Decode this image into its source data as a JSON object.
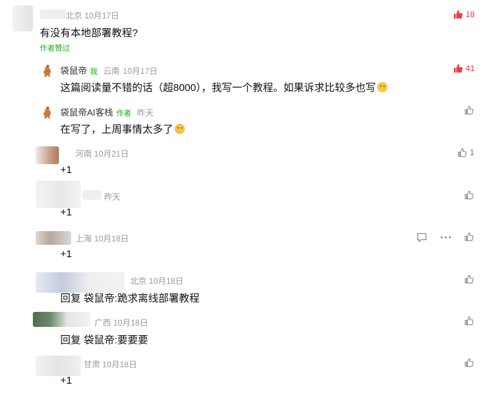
{
  "comments": [
    {
      "location": "北京",
      "date": "10月17日",
      "text": "有没有本地部署教程?",
      "author_liked": "作者赞过",
      "likes": "18"
    },
    {
      "name": "袋鼠帝",
      "tag": "我",
      "location": "云南",
      "date": "10月17日",
      "text": "这篇阅读量不错的话（超8000），我写一个教程。如果诉求比较多也写",
      "likes": "41"
    },
    {
      "name": "袋鼠帝AI客栈",
      "tag": "作者",
      "date": "昨天",
      "text": "在写了，上周事情太多了"
    },
    {
      "location": "河南",
      "date": "10月21日",
      "text": "+1",
      "likes": "1"
    },
    {
      "date": "昨天",
      "text": "+1"
    },
    {
      "location": "上海",
      "date": "10月18日",
      "text": "+1"
    },
    {
      "location": "北京",
      "date": "10月18日",
      "reply_prefix": "回复",
      "reply_to": "袋鼠帝:",
      "text": "跪求离线部署教程"
    },
    {
      "location": "广西",
      "date": "10月18日",
      "reply_prefix": "回复",
      "reply_to": "袋鼠帝:",
      "text": "要要要"
    },
    {
      "location": "甘肃",
      "date": "10月18日",
      "text": "+1"
    }
  ],
  "icons": {
    "like": "thumbs-up-icon",
    "reply": "comment-icon",
    "more": "more-dots-icon",
    "avatar": "kangaroo-avatar-icon"
  },
  "colors": {
    "liked": "#e64340",
    "author_tag": "#1aad19",
    "meta": "#999999"
  }
}
